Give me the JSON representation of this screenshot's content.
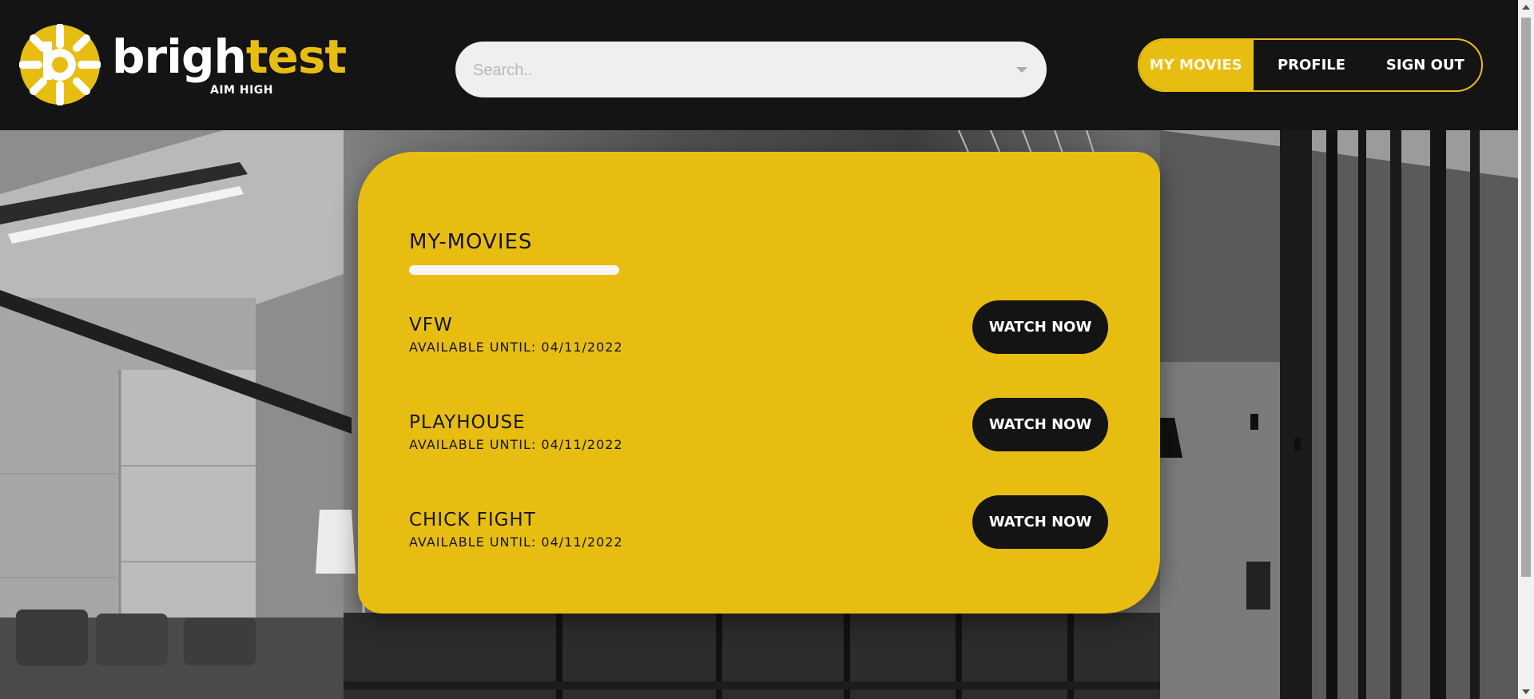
{
  "brand": {
    "name_part1": "brigh",
    "name_part2": "test",
    "tagline": "AIM HIGH",
    "accent_color": "#e8bd12",
    "logo_icon": "brightest-logo-icon"
  },
  "search": {
    "placeholder": "Search..",
    "dropdown_icon": "caret-down-icon"
  },
  "nav": {
    "items": [
      {
        "label": "MY MOVIES",
        "active": true
      },
      {
        "label": "PROFILE",
        "active": false
      },
      {
        "label": "SIGN OUT",
        "active": false
      }
    ]
  },
  "main": {
    "title": "MY-MOVIES",
    "movies": [
      {
        "title": "VFW",
        "availability": "AVAILABLE UNTIL: 04/11/2022",
        "button_label": "WATCH NOW"
      },
      {
        "title": "PLAYHOUSE",
        "availability": "AVAILABLE UNTIL: 04/11/2022",
        "button_label": "WATCH NOW"
      },
      {
        "title": "CHICK FIGHT",
        "availability": "AVAILABLE UNTIL: 04/11/2022",
        "button_label": "WATCH NOW"
      }
    ]
  }
}
